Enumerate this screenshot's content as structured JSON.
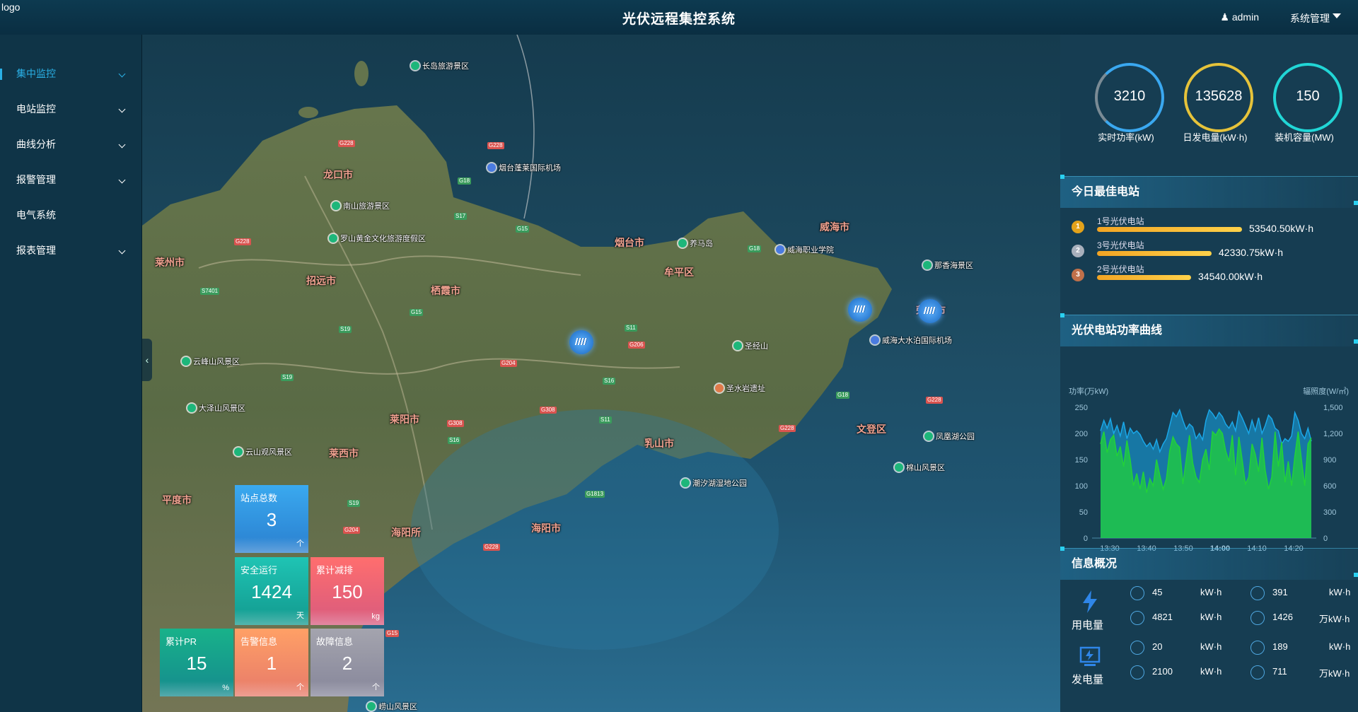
{
  "header": {
    "logo_alt": "logo",
    "title": "光伏远程集控系统",
    "user": "admin",
    "system_menu": "系统管理"
  },
  "sidebar": {
    "items": [
      {
        "label": "集中监控"
      },
      {
        "label": "电站监控"
      },
      {
        "label": "曲线分析"
      },
      {
        "label": "报警管理"
      },
      {
        "label": "电气系统"
      },
      {
        "label": "报表管理"
      }
    ]
  },
  "map": {
    "pois": [
      "长岛旅游景区",
      "烟台蓬莱国际机场",
      "南山旅游景区",
      "罗山黄金文化旅游度假区",
      "养马岛",
      "威海职业学院",
      "那香海景区",
      "云峰山风景区",
      "圣经山",
      "威海大水泊国际机场",
      "圣水岩遗址",
      "大泽山风景区",
      "云山观风景区",
      "凤凰湖公园",
      "棉山风景区",
      "潮汐湖湿地公园",
      "崂山风景区"
    ],
    "cities": [
      "龙口市",
      "招远市",
      "栖霞市",
      "烟台市",
      "牟平区",
      "威海市",
      "荣成市",
      "莱阳市",
      "莱西市",
      "海阳市",
      "乳山市",
      "平度市",
      "文登区",
      "海阳所",
      "莱州市"
    ],
    "roads": [
      "G228",
      "G228",
      "G18",
      "S17",
      "G15",
      "G228",
      "S7401",
      "G15",
      "S19",
      "G204",
      "S11",
      "G206",
      "S16",
      "G18",
      "G308",
      "G308",
      "S16",
      "S11",
      "S19",
      "G204",
      "G228",
      "G1813",
      "G228",
      "G228",
      "G18",
      "G15",
      "S19"
    ]
  },
  "tiles": [
    {
      "label": "站点总数",
      "value": "3",
      "unit": "个",
      "color": "#2f9de6"
    },
    {
      "label": "安全运行",
      "value": "1424",
      "unit": "天",
      "color": "#16b3a6"
    },
    {
      "label": "累计减排",
      "value": "150",
      "unit": "kg",
      "color": "#f26b6b"
    },
    {
      "label": "累计PR",
      "value": "15",
      "unit": "%",
      "color": "#18a87a"
    },
    {
      "label": "告警信息",
      "value": "1",
      "unit": "个",
      "color": "#f2955a"
    },
    {
      "label": "故障信息",
      "value": "2",
      "unit": "个",
      "color": "#9a9aa6"
    }
  ],
  "kpis": [
    {
      "value": "3210",
      "label": "实时功率(kW)",
      "color": "#3aa8f0"
    },
    {
      "value": "135628",
      "label": "日发电量(kW·h)",
      "color": "#e6c33a"
    },
    {
      "value": "150",
      "label": "装机容量(MW)",
      "color": "#21d6d6"
    }
  ],
  "best_today": {
    "title": "今日最佳电站",
    "items": [
      {
        "name": "1号光伏电站",
        "value": "53540.50kW·h",
        "rank": "1",
        "fraction": 1.0
      },
      {
        "name": "3号光伏电站",
        "value": "42330.75kW·h",
        "rank": "2",
        "fraction": 0.79
      },
      {
        "name": "2号光伏电站",
        "value": "34540.00kW·h",
        "rank": "3",
        "fraction": 0.65
      }
    ]
  },
  "power_curve": {
    "title": "光伏电站功率曲线"
  },
  "chart_data": {
    "type": "area",
    "title": "",
    "ylabel": "功率(万kW)",
    "y2label": "辐照度(W/㎡)",
    "xticks": [
      "13:30",
      "13:40",
      "13:50",
      "14:00",
      "14:10",
      "14:20"
    ],
    "yticks": [
      "250",
      "200",
      "150",
      "100",
      "50",
      "0"
    ],
    "y2ticks": [
      "1,500",
      "1,200",
      "900",
      "600",
      "300",
      "0"
    ],
    "ylim": [
      0,
      250
    ],
    "y2lim": [
      0,
      1500
    ],
    "series": [
      {
        "name": "功率(万kW)",
        "color": "#1aa7e8",
        "values": [
          205,
          225,
          210,
          228,
          200,
          215,
          195,
          222,
          190,
          210,
          200,
          205,
          198,
          185,
          175,
          182,
          170,
          188,
          165,
          180,
          190,
          215,
          240,
          232,
          245,
          225,
          208,
          218,
          212,
          190,
          200,
          188,
          225,
          245,
          238,
          228,
          240,
          232,
          218,
          210,
          222,
          205,
          242,
          230,
          215,
          200,
          225,
          205,
          230,
          200,
          215,
          235,
          228,
          210,
          205,
          180,
          190,
          185,
          195,
          240,
          225,
          200,
          190,
          210,
          185
        ]
      },
      {
        "name": "辐照度(W/㎡)",
        "color": "#22d13a",
        "values": [
          1080,
          1220,
          980,
          1130,
          1180,
          940,
          1050,
          820,
          1120,
          900,
          600,
          740,
          560,
          760,
          520,
          680,
          600,
          900,
          720,
          560,
          680,
          1000,
          1160,
          1080,
          1040,
          620,
          900,
          1180,
          860,
          700,
          640,
          900,
          1020,
          780,
          1220,
          1180,
          1250,
          1200,
          1000,
          880,
          1180,
          720,
          1160,
          900,
          620,
          700,
          1080,
          960,
          760,
          1150,
          780,
          560,
          700,
          1220,
          820,
          1100,
          640,
          880,
          600,
          940,
          1220,
          900,
          600,
          1080,
          1150
        ]
      }
    ]
  },
  "info": {
    "title": "信息概况",
    "usage": {
      "label": "用电量",
      "cells": [
        {
          "value": "45",
          "unit": "kW·h"
        },
        {
          "value": "391",
          "unit": "kW·h"
        },
        {
          "value": "4821",
          "unit": "kW·h"
        },
        {
          "value": "1426",
          "unit": "万kW·h"
        }
      ]
    },
    "generation": {
      "label": "发电量",
      "cells": [
        {
          "value": "20",
          "unit": "kW·h"
        },
        {
          "value": "189",
          "unit": "kW·h"
        },
        {
          "value": "2100",
          "unit": "kW·h"
        },
        {
          "value": "711",
          "unit": "万kW·h"
        }
      ]
    }
  }
}
